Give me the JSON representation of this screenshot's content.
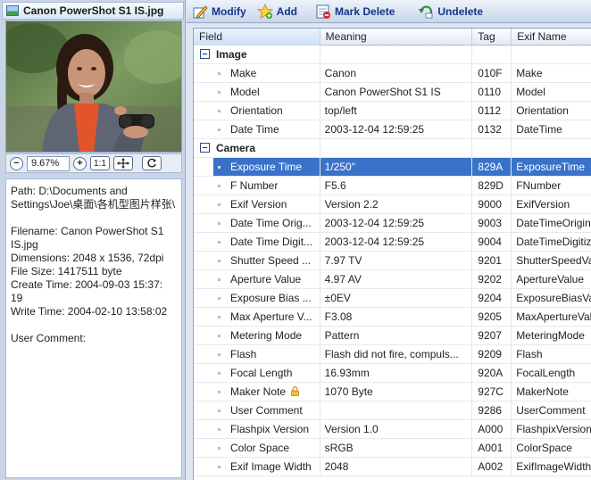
{
  "image_panel": {
    "file_title": "Canon PowerShot S1 IS.jpg",
    "zoom_value": "9.67%",
    "zoom_actual_label": "1:1"
  },
  "info": {
    "path_line1": "Path: D:\\Documents and",
    "path_line2": "Settings\\Joe\\桌面\\各机型图片样张\\",
    "filename_line1": "Filename: Canon PowerShot S1",
    "filename_line2": "IS.jpg",
    "dimensions": "Dimensions: 2048 x 1536, 72dpi",
    "file_size": "File Size: 1417511 byte",
    "create_time_line1": "Create Time: 2004-09-03 15:37:",
    "create_time_line2": "19",
    "write_time": "Write Time: 2004-02-10 13:58:02",
    "user_comment": "User Comment:"
  },
  "toolbar": {
    "modify": "Modify",
    "add": "Add",
    "mark_delete": "Mark Delete",
    "undelete": "Undelete"
  },
  "columns": {
    "field": "Field",
    "meaning": "Meaning",
    "tag": "Tag",
    "exif_name": "Exif Name"
  },
  "groups": {
    "image": "Image",
    "camera": "Camera"
  },
  "rows_image": [
    {
      "field": "Make",
      "meaning": "Canon",
      "tag": "010F",
      "exif": "Make"
    },
    {
      "field": "Model",
      "meaning": "Canon PowerShot S1 IS",
      "tag": "0110",
      "exif": "Model"
    },
    {
      "field": "Orientation",
      "meaning": "top/left",
      "tag": "0112",
      "exif": "Orientation"
    },
    {
      "field": "Date Time",
      "meaning": "2003-12-04 12:59:25",
      "tag": "0132",
      "exif": "DateTime"
    }
  ],
  "rows_camera": [
    {
      "field": "Exposure Time",
      "meaning": "1/250\"",
      "tag": "829A",
      "exif": "ExposureTime"
    },
    {
      "field": "F Number",
      "meaning": "F5.6",
      "tag": "829D",
      "exif": "FNumber"
    },
    {
      "field": "Exif Version",
      "meaning": "Version 2.2",
      "tag": "9000",
      "exif": "ExifVersion"
    },
    {
      "field": "Date Time Orig...",
      "meaning": "2003-12-04 12:59:25",
      "tag": "9003",
      "exif": "DateTimeOrigin"
    },
    {
      "field": "Date Time Digit...",
      "meaning": "2003-12-04 12:59:25",
      "tag": "9004",
      "exif": "DateTimeDigitiz"
    },
    {
      "field": "Shutter Speed ...",
      "meaning": "7.97 TV",
      "tag": "9201",
      "exif": "ShutterSpeedVa"
    },
    {
      "field": "Aperture Value",
      "meaning": "4.97 AV",
      "tag": "9202",
      "exif": "ApertureValue"
    },
    {
      "field": "Exposure Bias ...",
      "meaning": "±0EV",
      "tag": "9204",
      "exif": "ExposureBiasVa"
    },
    {
      "field": "Max Aperture V...",
      "meaning": "F3.08",
      "tag": "9205",
      "exif": "MaxApertureVal"
    },
    {
      "field": "Metering Mode",
      "meaning": "Pattern",
      "tag": "9207",
      "exif": "MeteringMode"
    },
    {
      "field": "Flash",
      "meaning": "Flash did not fire, compuls...",
      "tag": "9209",
      "exif": "Flash"
    },
    {
      "field": "Focal Length",
      "meaning": "16.93mm",
      "tag": "920A",
      "exif": "FocalLength"
    },
    {
      "field": "Maker Note",
      "meaning": "1070 Byte",
      "tag": "927C",
      "exif": "MakerNote"
    },
    {
      "field": "User Comment",
      "meaning": "",
      "tag": "9286",
      "exif": "UserComment"
    },
    {
      "field": "Flashpix Version",
      "meaning": "Version 1.0",
      "tag": "A000",
      "exif": "FlashpixVersion"
    },
    {
      "field": "Color Space",
      "meaning": "sRGB",
      "tag": "A001",
      "exif": "ColorSpace"
    },
    {
      "field": "Exif Image Width",
      "meaning": "2048",
      "tag": "A002",
      "exif": "ExifImageWidth"
    }
  ],
  "colors": {
    "selection": "#3a72c9",
    "toolbar_text": "#12348a",
    "panel_bg": "#c9d5e6"
  },
  "icons": {
    "title": "picture-icon",
    "modify": "pencil-icon",
    "add": "star-icon",
    "mark_delete": "delete-mark-icon",
    "undelete": "undelete-arrow-icon",
    "maker_note": "lock-icon"
  }
}
